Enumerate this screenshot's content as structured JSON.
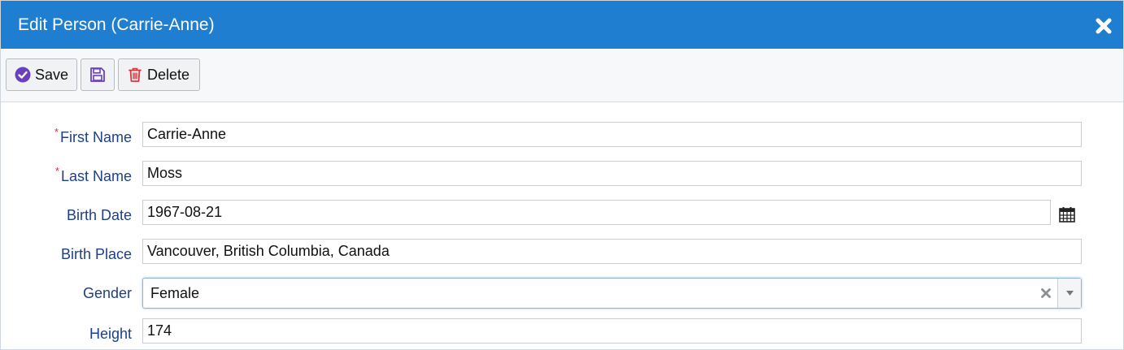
{
  "dialog": {
    "title": "Edit Person (Carrie-Anne)",
    "close_icon": "close-icon"
  },
  "toolbar": {
    "save_label": "Save",
    "save_icon": "check-circle-icon",
    "disk_icon": "floppy-disk-icon",
    "delete_label": "Delete",
    "delete_icon": "trash-icon"
  },
  "form": {
    "first_name": {
      "label": "First Name",
      "required": true,
      "value": "Carrie-Anne"
    },
    "last_name": {
      "label": "Last Name",
      "required": true,
      "value": "Moss"
    },
    "birth_date": {
      "label": "Birth Date",
      "value": "1967-08-21",
      "icon": "calendar-icon"
    },
    "birth_place": {
      "label": "Birth Place",
      "value": "Vancouver, British Columbia, Canada"
    },
    "gender": {
      "label": "Gender",
      "value": "Female",
      "clear_icon": "clear-x-icon",
      "arrow_icon": "dropdown-arrow-icon"
    },
    "height": {
      "label": "Height",
      "value": "174"
    }
  },
  "colors": {
    "titlebar": "#1f7ecf",
    "label": "#1d3f8a",
    "required": "#e03030",
    "save_icon": "#6a3fc0",
    "delete_icon": "#d9363e"
  }
}
